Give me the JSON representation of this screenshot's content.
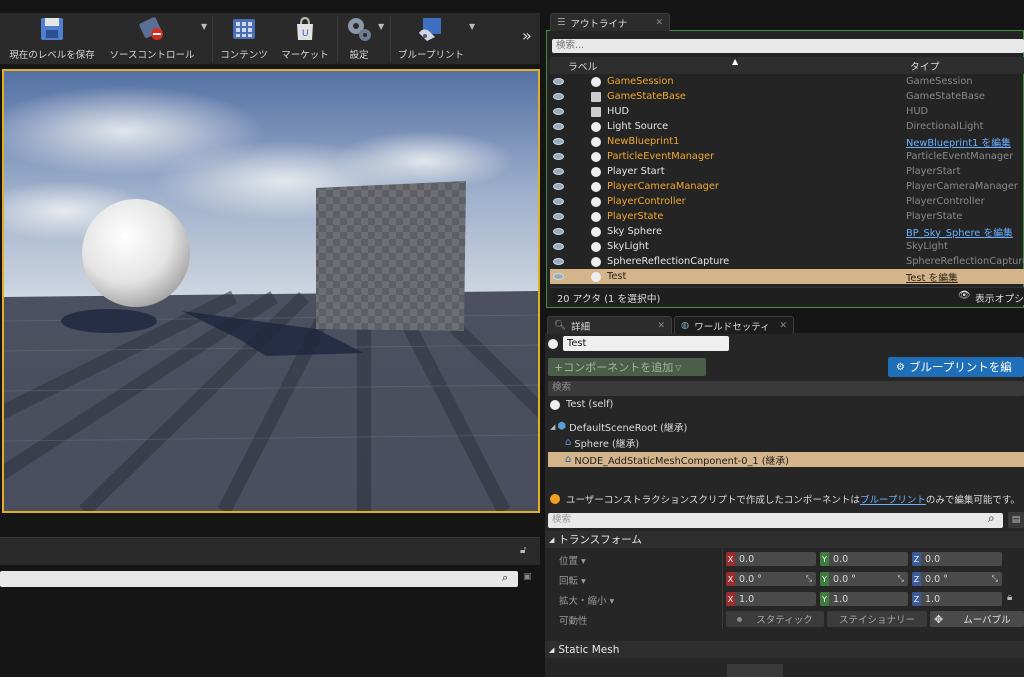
{
  "toolbar": {
    "save_label": "現在のレベルを保存",
    "source_control_label": "ソースコントロール",
    "content_label": "コンテンツ",
    "market_label": "マーケット",
    "settings_label": "設定",
    "blueprint_label": "ブループリント",
    "more_label": "»"
  },
  "outliner": {
    "tab_label": "アウトライナ",
    "search_placeholder": "検索...",
    "col_label": "ラベル",
    "col_type": "タイプ",
    "rows": [
      {
        "label": "GameSession",
        "type": "GameSession"
      },
      {
        "label": "GameStateBase",
        "type": "GameStateBase"
      },
      {
        "label": "HUD",
        "type": "HUD"
      },
      {
        "label": "Light Source",
        "type": "DirectionalLight"
      },
      {
        "label": "NewBlueprint1",
        "type": "NewBlueprint1 を編集"
      },
      {
        "label": "ParticleEventManager",
        "type": "ParticleEventManager"
      },
      {
        "label": "Player Start",
        "type": "PlayerStart"
      },
      {
        "label": "PlayerCameraManager",
        "type": "PlayerCameraManager"
      },
      {
        "label": "PlayerController",
        "type": "PlayerController"
      },
      {
        "label": "PlayerState",
        "type": "PlayerState"
      },
      {
        "label": "Sky Sphere",
        "type": "BP_Sky_Sphere を編集"
      },
      {
        "label": "SkyLight",
        "type": "SkyLight"
      },
      {
        "label": "SphereReflectionCapture",
        "type": "SphereReflectionCapture"
      },
      {
        "label": "Test",
        "type": "Test を編集"
      }
    ],
    "footer_count": "20 アクタ (1 を選択中)",
    "view_options": "表示オプシ"
  },
  "details": {
    "tab_details": "詳細",
    "tab_world": "ワールドセッティ",
    "name_value": "Test",
    "add_component": "+コンポーネントを追加",
    "blueprint_button": "ブループリントを編",
    "search_placeholder": "検索",
    "self_item": "Test (self)",
    "tree": [
      "DefaultSceneRoot (継承)",
      "Sphere (継承)",
      "NODE_AddStaticMeshComponent-0_1 (継承)"
    ],
    "info_prefix": "ユーザーコンストラクションスクリプトで作成したコンポーネントは ",
    "info_link": "ブループリント",
    "info_suffix": " のみで編集可能です。",
    "prop_search_placeholder": "検索",
    "transform_section": "トランスフォーム",
    "location_label": "位置 ▾",
    "rotation_label": "回転 ▾",
    "scale_label": "拡大・縮小 ▾",
    "mobility_label": "可動性",
    "axis_x": "X",
    "axis_y": "Y",
    "axis_z": "Z",
    "location": [
      "0.0",
      "0.0",
      "0.0"
    ],
    "rotation": [
      "0.0 °",
      "0.0 °",
      "0.0 °"
    ],
    "scale": [
      "1.0",
      "1.0",
      "1.0"
    ],
    "mobility_static": "スタティック",
    "mobility_stationary": "ステイショナリー",
    "mobility_movable": "ムーバブル",
    "static_mesh_section": "Static Mesh"
  },
  "colors": {
    "accent_select": "#d4b48a",
    "link": "#6bb0ff",
    "actor_label": "#f0a830",
    "viewport_border": "#e0b020",
    "blueprint_button": "#1f6fb8"
  }
}
